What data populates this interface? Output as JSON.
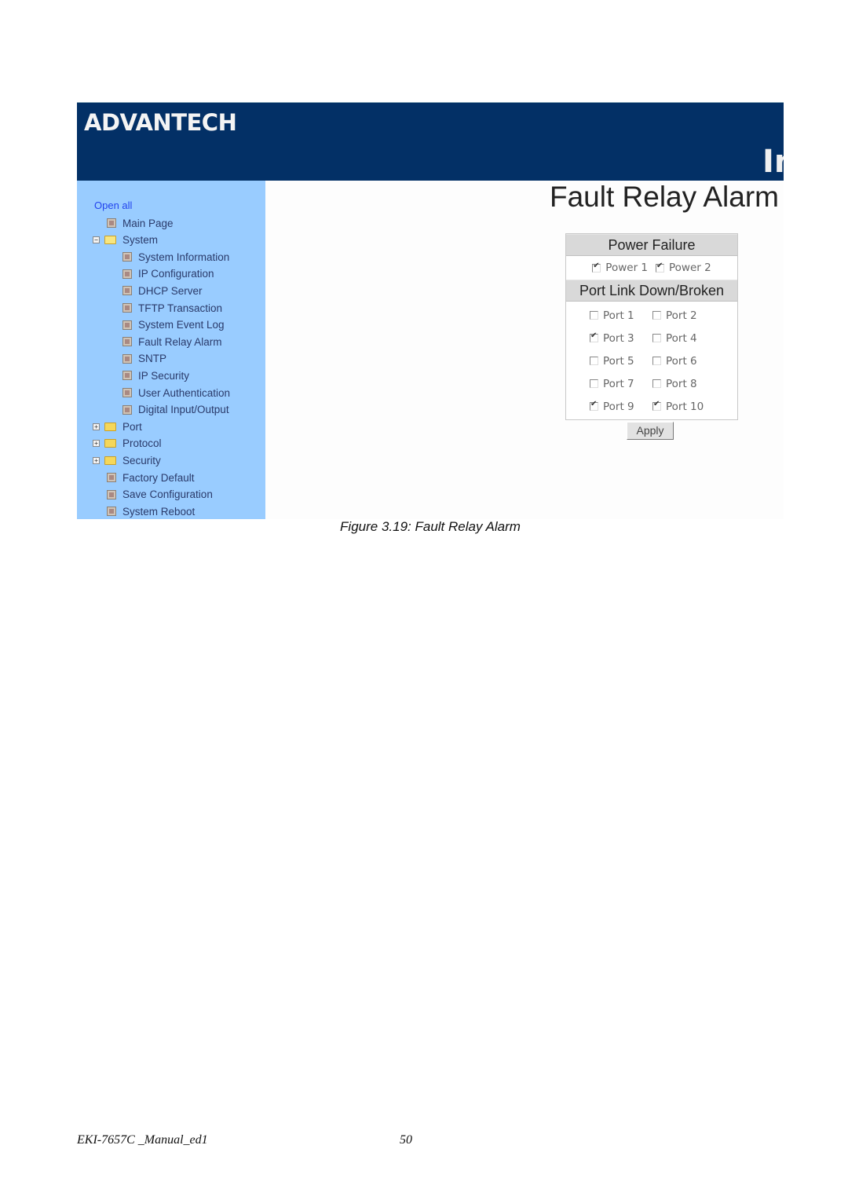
{
  "banner": {
    "logo_text": "ADVANTECH",
    "partial_title": "In"
  },
  "sidebar": {
    "open_all": "Open all",
    "items": [
      {
        "label": "Main Page",
        "type": "page",
        "level": 0
      },
      {
        "label": "System",
        "type": "folder",
        "expanded": true,
        "level": 0
      },
      {
        "label": "System Information",
        "type": "page",
        "level": 1
      },
      {
        "label": "IP Configuration",
        "type": "page",
        "level": 1
      },
      {
        "label": "DHCP Server",
        "type": "page",
        "level": 1
      },
      {
        "label": "TFTP Transaction",
        "type": "page",
        "level": 1
      },
      {
        "label": "System Event Log",
        "type": "page",
        "level": 1
      },
      {
        "label": "Fault Relay Alarm",
        "type": "page",
        "level": 1
      },
      {
        "label": "SNTP",
        "type": "page",
        "level": 1
      },
      {
        "label": "IP Security",
        "type": "page",
        "level": 1
      },
      {
        "label": "User Authentication",
        "type": "page",
        "level": 1
      },
      {
        "label": "Digital Input/Output",
        "type": "page",
        "level": 1
      },
      {
        "label": "Port",
        "type": "folder",
        "expanded": false,
        "level": 0
      },
      {
        "label": "Protocol",
        "type": "folder",
        "expanded": false,
        "level": 0
      },
      {
        "label": "Security",
        "type": "folder",
        "expanded": false,
        "level": 0
      },
      {
        "label": "Factory Default",
        "type": "page",
        "level": 0
      },
      {
        "label": "Save Configuration",
        "type": "page",
        "level": 0
      },
      {
        "label": "System Reboot",
        "type": "page",
        "level": 0
      }
    ]
  },
  "main": {
    "title": "Fault Relay Alarm",
    "power_section": {
      "heading": "Power Failure",
      "options": [
        {
          "label": "Power 1",
          "checked": true
        },
        {
          "label": "Power 2",
          "checked": true
        }
      ]
    },
    "port_section": {
      "heading": "Port Link Down/Broken",
      "ports": [
        {
          "label": "Port 1",
          "checked": false
        },
        {
          "label": "Port 2",
          "checked": false
        },
        {
          "label": "Port 3",
          "checked": true
        },
        {
          "label": "Port 4",
          "checked": false
        },
        {
          "label": "Port 5",
          "checked": false
        },
        {
          "label": "Port 6",
          "checked": false
        },
        {
          "label": "Port 7",
          "checked": false
        },
        {
          "label": "Port 8",
          "checked": false
        },
        {
          "label": "Port 9",
          "checked": true
        },
        {
          "label": "Port 10",
          "checked": true
        }
      ]
    },
    "apply_label": "Apply"
  },
  "caption": "Figure 3.19: Fault Relay Alarm",
  "footer": {
    "doc_name": "EKI-7657C _Manual_ed1",
    "page_number": "50"
  }
}
